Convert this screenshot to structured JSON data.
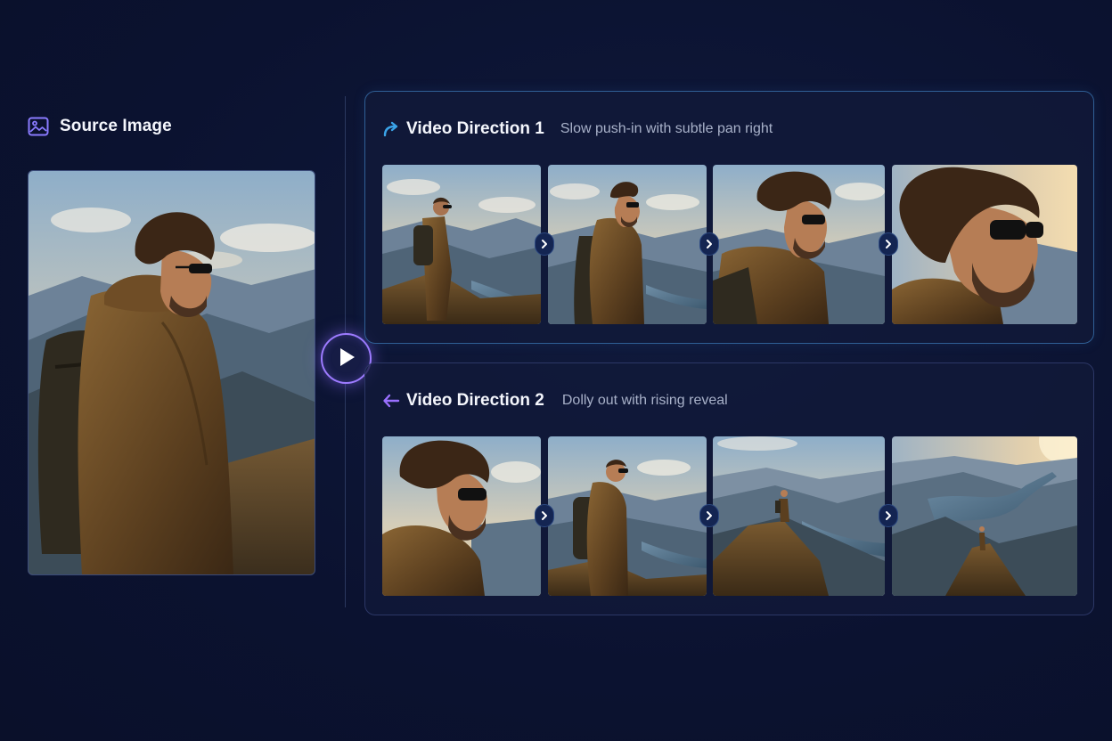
{
  "source": {
    "title": "Source Image",
    "icon": "image-icon"
  },
  "center_control": {
    "icon": "play-icon"
  },
  "directions": [
    {
      "title": "Video Direction 1",
      "subtitle": "Slow push-in with subtle pan right",
      "icon": "curved-arrow-right-icon",
      "accent": "#3aa3e8",
      "frames": [
        "frame-1",
        "frame-2",
        "frame-3",
        "frame-4"
      ]
    },
    {
      "title": "Video Direction 2",
      "subtitle": "Dolly out with rising reveal",
      "icon": "arrow-left-icon",
      "accent": "#9a70ff",
      "frames": [
        "frame-1",
        "frame-2",
        "frame-3",
        "frame-4"
      ]
    }
  ],
  "colors": {
    "background": "#0b1230",
    "panel_border_active": "#2f5f95",
    "panel_border": "#2c3766",
    "play_ring": "#9d7bff",
    "subtitle": "#a8b1c9"
  }
}
